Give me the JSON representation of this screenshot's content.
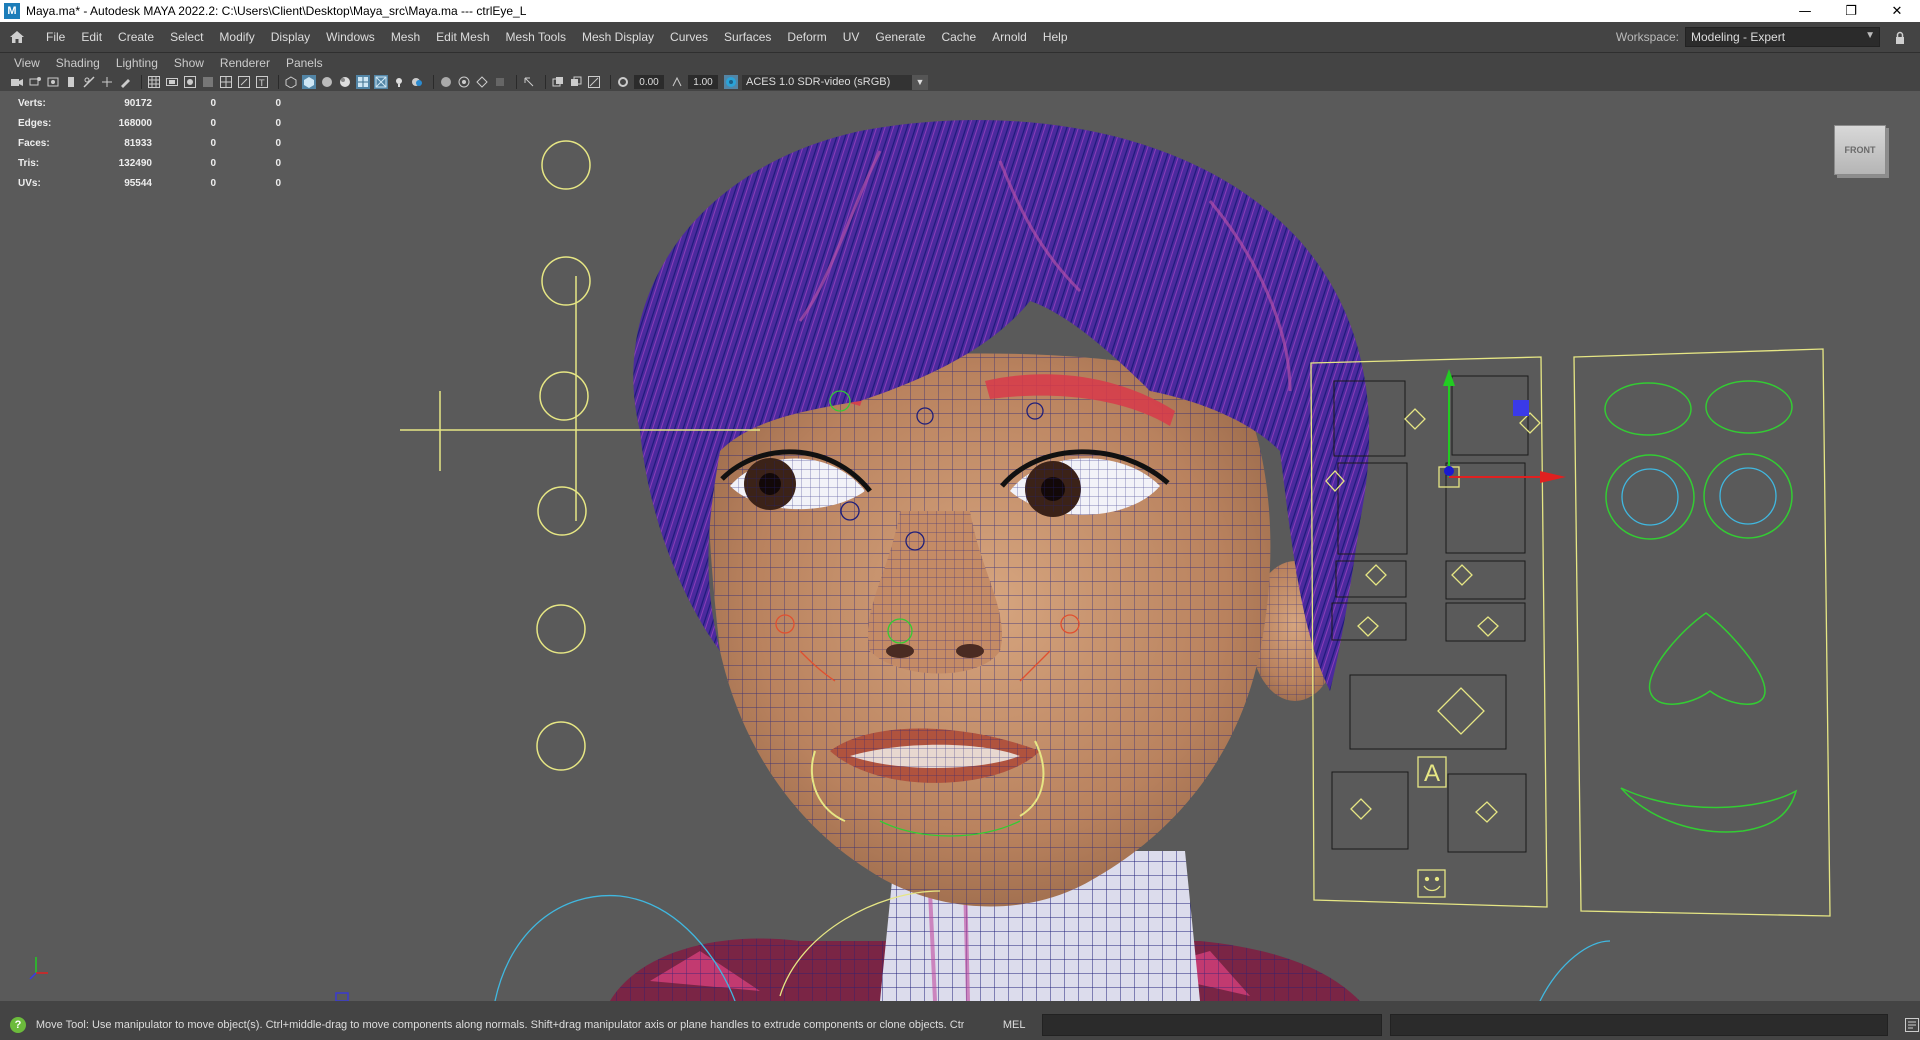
{
  "window": {
    "title": "Maya.ma* - Autodesk MAYA 2022.2: C:\\Users\\Client\\Desktop\\Maya_src\\Maya.ma   ---   ctrlEye_L",
    "app_icon": "M",
    "controls": [
      "—",
      "❐",
      "✕"
    ]
  },
  "menubar": {
    "items": [
      "File",
      "Edit",
      "Create",
      "Select",
      "Modify",
      "Display",
      "Windows",
      "Mesh",
      "Edit Mesh",
      "Mesh Tools",
      "Mesh Display",
      "Curves",
      "Surfaces",
      "Deform",
      "UV",
      "Generate",
      "Cache",
      "Arnold",
      "Help"
    ],
    "workspace_label": "Workspace:",
    "workspace_value": "Modeling - Expert"
  },
  "panel_menu": {
    "items": [
      "View",
      "Shading",
      "Lighting",
      "Show",
      "Renderer",
      "Panels"
    ]
  },
  "panel_toolbar": {
    "near_clip": "0.00",
    "exposure": "1.00",
    "color_space": "ACES 1.0 SDR-video (sRGB)"
  },
  "hud": {
    "rows": [
      {
        "label": "Verts:",
        "values": [
          "90172",
          "0",
          "0"
        ]
      },
      {
        "label": "Edges:",
        "values": [
          "168000",
          "0",
          "0"
        ]
      },
      {
        "label": "Faces:",
        "values": [
          "81933",
          "0",
          "0"
        ]
      },
      {
        "label": "Tris:",
        "values": [
          "132490",
          "0",
          "0"
        ]
      },
      {
        "label": "UVs:",
        "values": [
          "95544",
          "0",
          "0"
        ]
      }
    ]
  },
  "viewcube_label": "FRONT",
  "rig_panel": {
    "letter": "A"
  },
  "colors": {
    "viewport_bg": "#5a5a5a",
    "wire": "#1f1f7a",
    "control_yellow": "#e6e684",
    "control_green": "#33cc33",
    "hair": "#5a2fa8",
    "skin": "#c8946d"
  },
  "status": {
    "help_text": "Move Tool: Use manipulator to move object(s). Ctrl+middle-drag to move components along normals. Shift+drag manipulator axis or plane handles to extrude components or clone objects. Ctrl+Shift+drag to con",
    "language": "MEL"
  }
}
